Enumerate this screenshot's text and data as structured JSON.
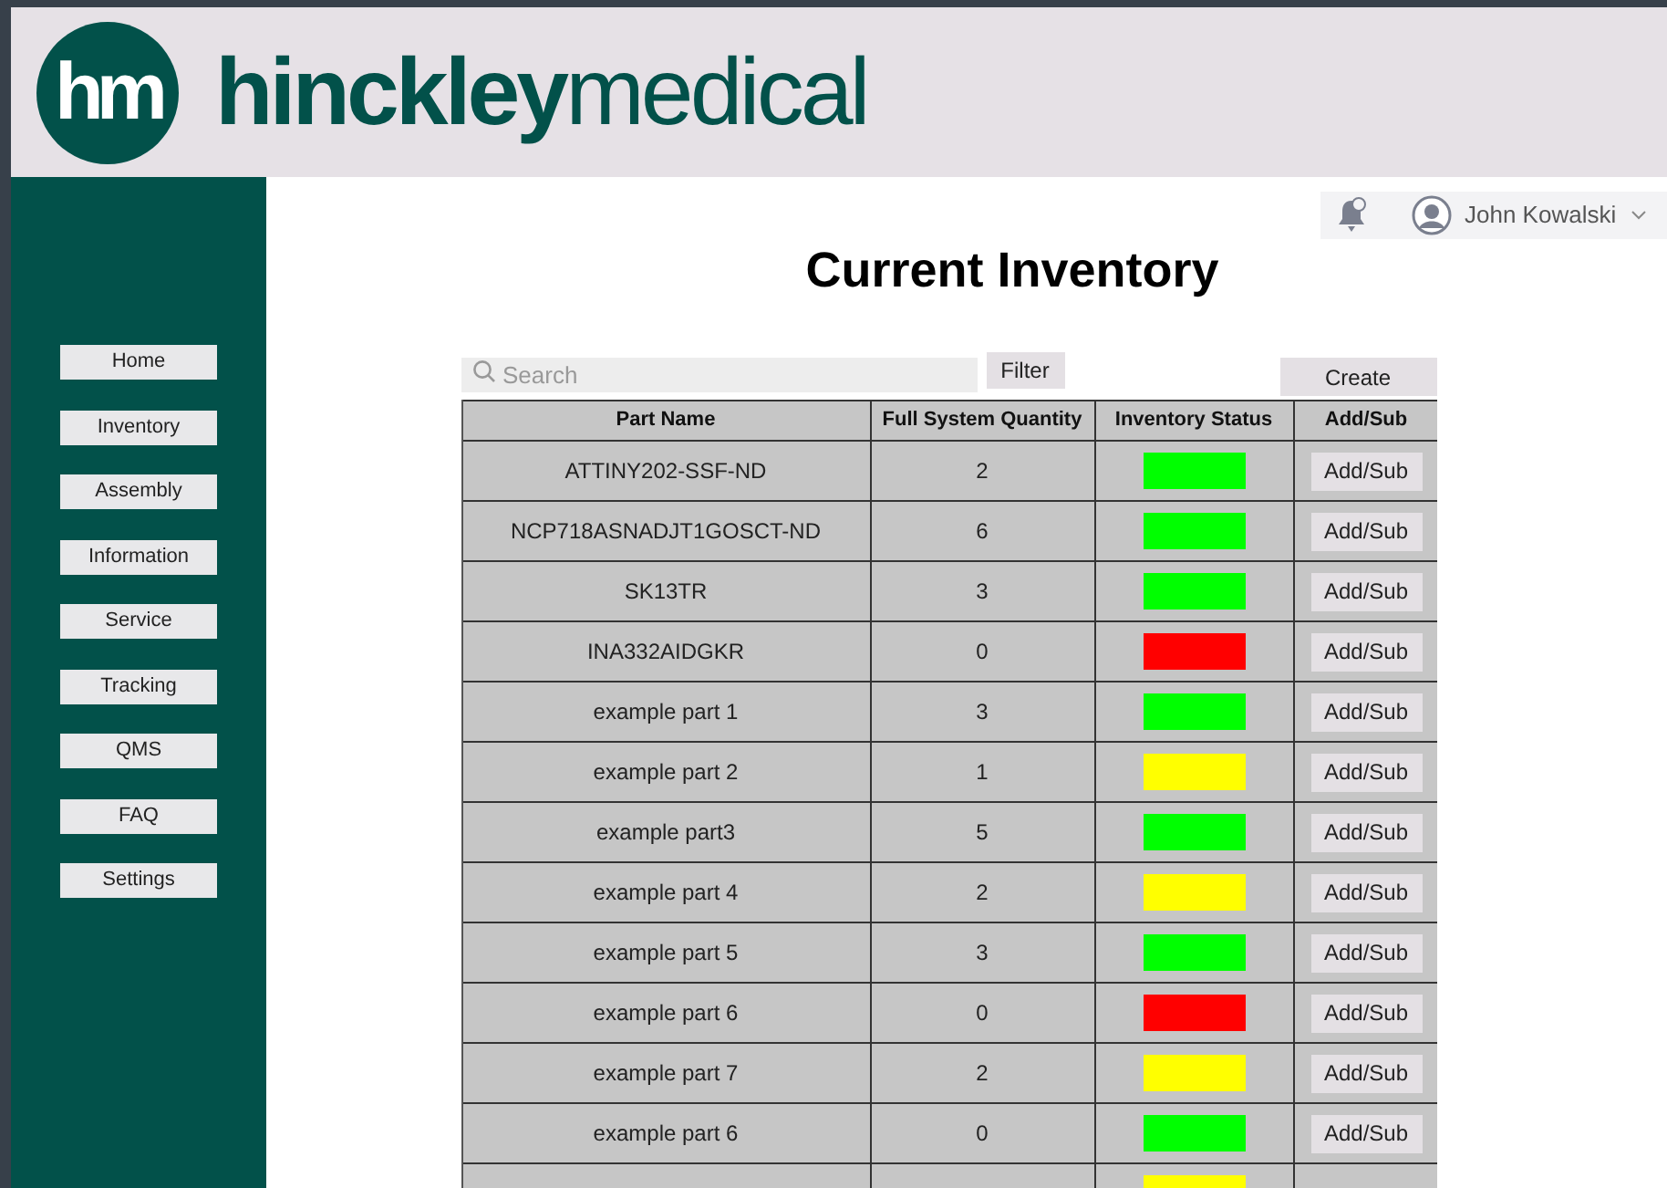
{
  "header": {
    "logo_mark": "hm",
    "logo_text": "**hinckley**medical"
  },
  "user": {
    "name": "John Kowalski"
  },
  "sidebar": {
    "items": [
      "Home",
      "Inventory",
      "Assembly",
      "Information",
      "Service",
      "Tracking",
      "QMS",
      "FAQ",
      "Settings"
    ]
  },
  "title": "Current Inventory",
  "search": {
    "placeholder": "Search"
  },
  "filter_button": "Filter",
  "create_button": "Create",
  "table": {
    "columns": [
      "Part Name",
      "Full System Quantity",
      "Inventory Status",
      "Add/Sub"
    ],
    "rows": [
      {
        "part": "ATTINY202-SSF-ND",
        "quantity": "2",
        "color": "#00ff00",
        "action": "Add/Sub"
      },
      {
        "part": "NCP718ASNADJT1GOSCT-ND",
        "quantity": "6",
        "color": "#00ff00",
        "action": "Add/Sub"
      },
      {
        "part": "SK13TR",
        "quantity": "3",
        "color": "#00ff00",
        "action": "Add/Sub"
      },
      {
        "part": "INA332AIDGKR",
        "quantity": "0",
        "color": "#ff0000",
        "action": "Add/Sub"
      },
      {
        "part": "example part 1",
        "quantity": "3",
        "color": "#00ff00",
        "action": "Add/Sub"
      },
      {
        "part": "example part 2",
        "quantity": "1",
        "color": "#ffff00",
        "action": "Add/Sub"
      },
      {
        "part": "example part3",
        "quantity": "5",
        "color": "#00ff00",
        "action": "Add/Sub"
      },
      {
        "part": "example part 4",
        "quantity": "2",
        "color": "#ffff00",
        "action": "Add/Sub"
      },
      {
        "part": "example part 5",
        "quantity": "3",
        "color": "#00ff00",
        "action": "Add/Sub"
      },
      {
        "part": "example part 6",
        "quantity": "0",
        "color": "#ff0000",
        "action": "Add/Sub"
      },
      {
        "part": "example part 7",
        "quantity": "2",
        "color": "#ffff00",
        "action": "Add/Sub"
      },
      {
        "part": "example part 6",
        "quantity": "0",
        "color": "#00ff00",
        "action": "Add/Sub"
      },
      {
        "color": "#ffff00"
      }
    ]
  }
}
